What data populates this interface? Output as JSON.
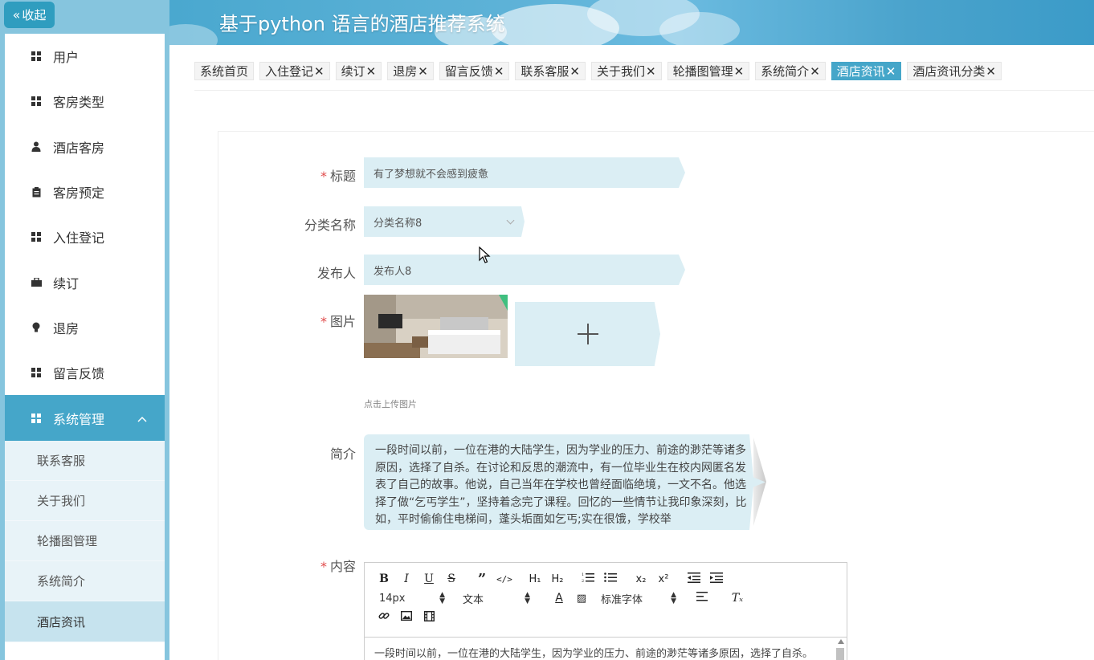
{
  "sidebar": {
    "collapse_label": "收起",
    "items": [
      {
        "label": "用户",
        "icon": "grid-icon"
      },
      {
        "label": "客房类型",
        "icon": "grid-icon"
      },
      {
        "label": "酒店客房",
        "icon": "person-icon"
      },
      {
        "label": "客房预定",
        "icon": "clipboard-icon"
      },
      {
        "label": "入住登记",
        "icon": "grid-icon"
      },
      {
        "label": "续订",
        "icon": "briefcase-icon"
      },
      {
        "label": "退房",
        "icon": "bulb-icon"
      },
      {
        "label": "留言反馈",
        "icon": "grid-icon"
      }
    ],
    "group": {
      "label": "系统管理",
      "expanded": true
    },
    "submenu": [
      {
        "label": "联系客服"
      },
      {
        "label": "关于我们"
      },
      {
        "label": "轮播图管理"
      },
      {
        "label": "系统简介"
      },
      {
        "label": "酒店资讯",
        "active": true
      }
    ]
  },
  "header": {
    "title": "基于python 语言的酒店推荐系统"
  },
  "tabs": [
    {
      "label": "系统首页",
      "closable": false
    },
    {
      "label": "入住登记",
      "closable": true
    },
    {
      "label": "续订",
      "closable": true
    },
    {
      "label": "退房",
      "closable": true
    },
    {
      "label": "留言反馈",
      "closable": true
    },
    {
      "label": "联系客服",
      "closable": true
    },
    {
      "label": "关于我们",
      "closable": true
    },
    {
      "label": "轮播图管理",
      "closable": true
    },
    {
      "label": "系统简介",
      "closable": true
    },
    {
      "label": "酒店资讯",
      "closable": true,
      "active": true
    },
    {
      "label": "酒店资讯分类",
      "closable": true
    }
  ],
  "form": {
    "title_label": "标题",
    "title_value": "有了梦想就不会感到疲惫",
    "category_label": "分类名称",
    "category_value": "分类名称8",
    "publisher_label": "发布人",
    "publisher_value": "发布人8",
    "image_label": "图片",
    "upload_hint": "点击上传图片",
    "intro_label": "简介",
    "intro_text": "一段时间以前，一位在港的大陆学生，因为学业的压力、前途的渺茫等诸多原因，选择了自杀。在讨论和反思的潮流中，有一位毕业生在校内网匿名发表了自己的故事。他说，自己当年在学校也曾经面临绝境，一文不名。他选择了做“乞丐学生”，坚持着念完了课程。回忆的一些情节让我印象深刻，比如，平时偷偷住电梯间，蓬头垢面如乞丐;实在很饿，学校举",
    "content_label": "内容",
    "content_text": "一段时间以前，一位在港的大陆学生，因为学业的压力、前途的渺茫等诸多原因，选择了自杀。"
  },
  "editor": {
    "font_size": "14px",
    "block_format": "文本",
    "font_family": "标准字体"
  },
  "colors": {
    "accent": "#45a6c9",
    "sidebar_bg": "#86c5de",
    "field_bg": "#dbeef4",
    "required": "#e04a4a"
  }
}
